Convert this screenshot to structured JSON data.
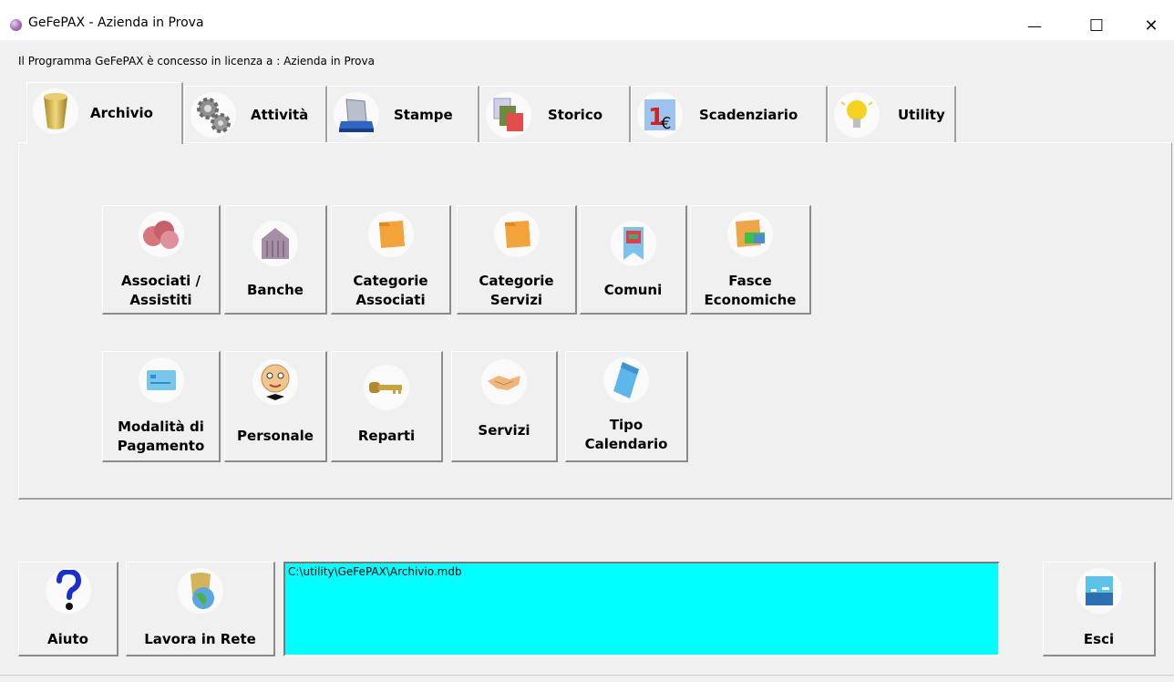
{
  "window": {
    "title": "GeFePAX - Azienda in Prova",
    "minimize": "—",
    "maximize": "☐",
    "close": "✕"
  },
  "license_text": "Il Programma GeFePAX è concesso in licenza a : Azienda in Prova",
  "tabs": [
    {
      "label": "Archivio",
      "icon": "archive-cylinder-icon",
      "active": true
    },
    {
      "label": "Attività",
      "icon": "gears-icon",
      "active": false
    },
    {
      "label": "Stampe",
      "icon": "printer-icon",
      "active": false
    },
    {
      "label": "Storico",
      "icon": "history-docs-icon",
      "active": false
    },
    {
      "label": "Scadenziario",
      "icon": "euro-calendar-icon",
      "active": false
    },
    {
      "label": "Utility",
      "icon": "lightbulb-icon",
      "active": false
    }
  ],
  "archive_buttons_row1": [
    {
      "label": "Associati /\nAssistiti",
      "icon": "people-icon"
    },
    {
      "label": "Banche",
      "icon": "bank-icon"
    },
    {
      "label": "Categorie\nAssociati",
      "icon": "folder-icon"
    },
    {
      "label": "Categorie\nServizi",
      "icon": "folder-icon"
    },
    {
      "label": "Comuni",
      "icon": "town-banner-icon"
    },
    {
      "label": "Fasce\nEconomiche",
      "icon": "money-folder-icon"
    }
  ],
  "archive_buttons_row2": [
    {
      "label": "Modalità di\nPagamento",
      "icon": "credit-card-icon"
    },
    {
      "label": "Personale",
      "icon": "person-face-icon"
    },
    {
      "label": "Reparti",
      "icon": "key-icon"
    },
    {
      "label": "Servizi",
      "icon": "handshake-icon"
    },
    {
      "label": "Tipo\nCalendario",
      "icon": "calendar-icon"
    }
  ],
  "bottom": {
    "help_label": "Aiuto",
    "network_label": "Lavora in Rete",
    "db_path": "C:\\utility\\GeFePAX\\Archivio.mdb",
    "exit_label": "Esci"
  },
  "colors": {
    "path_box_bg": "#00ffff",
    "window_bg": "#f0f0f0"
  }
}
